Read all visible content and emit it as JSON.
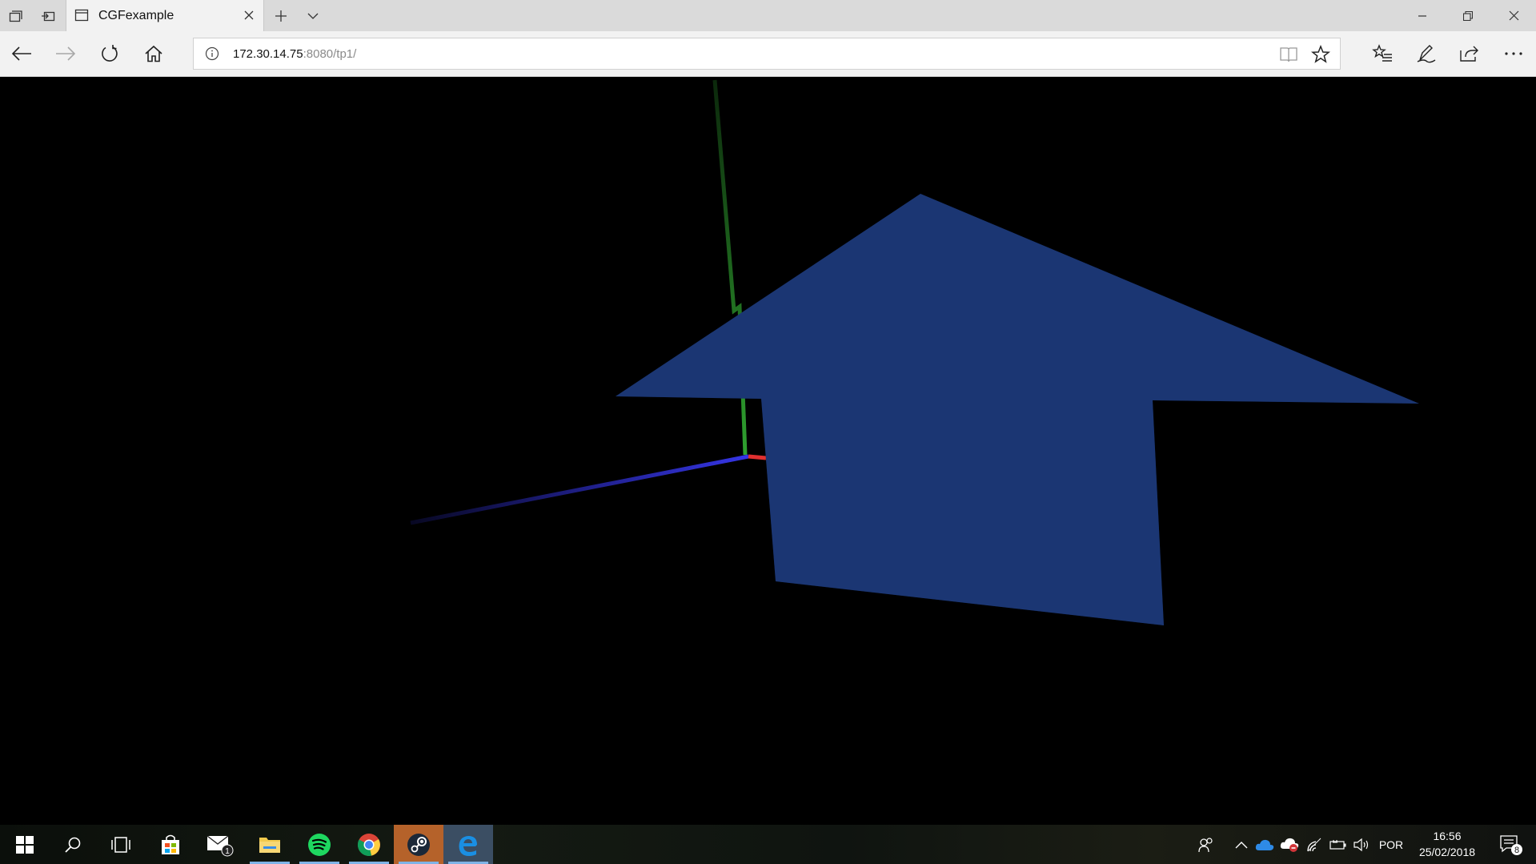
{
  "browser": {
    "tab": {
      "title": "CGFexample"
    },
    "address": {
      "host": "172.30.14.75",
      "rest": ":8080/tp1/"
    }
  },
  "scene": {
    "background": "#000000",
    "shape_color": "#1f3a78",
    "axis_colors": {
      "x": "#e03030",
      "y": "#2fa12f",
      "z": "#3535e6"
    }
  },
  "taskbar": {
    "apps": [
      "start",
      "search",
      "task-view",
      "store",
      "mail",
      "file-explorer",
      "spotify",
      "chrome",
      "steam",
      "edge"
    ],
    "mail_badge": "1",
    "tray": {
      "language": "POR",
      "time": "16:56",
      "date": "25/02/2018",
      "notification_count": "8"
    }
  }
}
